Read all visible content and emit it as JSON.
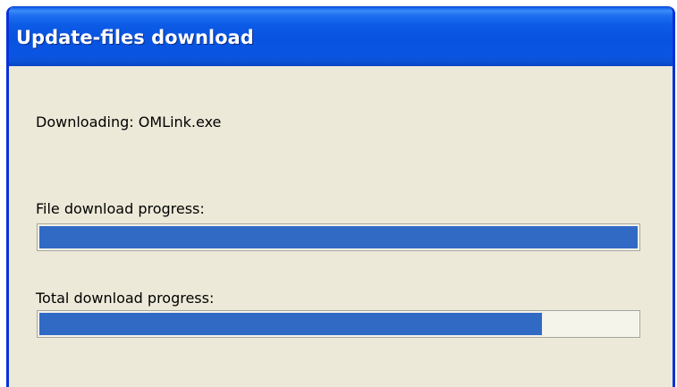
{
  "window": {
    "title": "Update-files download"
  },
  "content": {
    "downloading_label": "Downloading: OMLink.exe",
    "file_progress_label": "File download progress:",
    "total_progress_label": "Total download progress:"
  },
  "progress": {
    "file_fraction": 1.0,
    "total_fraction": 0.84,
    "fill_color": "#316ac5"
  },
  "colors": {
    "titlebar_blue": "#0853df",
    "window_bg": "#ece9d8",
    "border_blue": "#0831d9"
  }
}
